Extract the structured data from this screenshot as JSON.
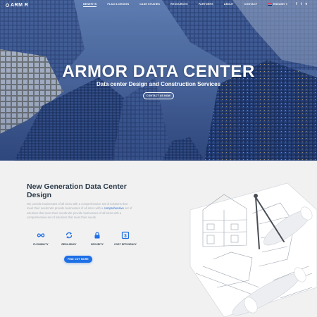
{
  "nav": {
    "logo": "ARM R",
    "links": [
      "BENEFITS",
      "PLAN & DESIGN",
      "CASE STUDIES",
      "RESOURCES",
      "PARTNERS",
      "ABOUT",
      "CONTACT"
    ],
    "language": "ENGLISH",
    "social": [
      "f",
      "t",
      "v"
    ]
  },
  "hero": {
    "title": "ARMOR DATA CENTER",
    "subtitle": "Data center Design and Construction Services",
    "button": "CONTACT US NOW"
  },
  "section": {
    "title": "New Generation Data Center Design",
    "text_1": "We provide businesses of all sizes with a comprehensive set of solutions that meet their needs.We provide businesses of all sizes with a ",
    "text_link": "comprehensive",
    "text_2": " set of solutions that meet their needs.We provide businesses of all sizes with a comprehensive set of solutions that meet their needs.",
    "features": [
      {
        "icon": "infinity-icon",
        "label": "FLEXIBILITY"
      },
      {
        "icon": "refresh-icon",
        "label": "RESILIENCY"
      },
      {
        "icon": "lock-icon",
        "label": "SECURITY"
      },
      {
        "icon": "dollar-icon",
        "label": "COST EFFICIENCY"
      }
    ],
    "cta": "FIND OUT MORE"
  },
  "colors": {
    "accent": "#1f6fe6",
    "heading": "#2a3a4a",
    "body_text": "#aab0b8",
    "hero_sky": "#4c6aa0"
  }
}
